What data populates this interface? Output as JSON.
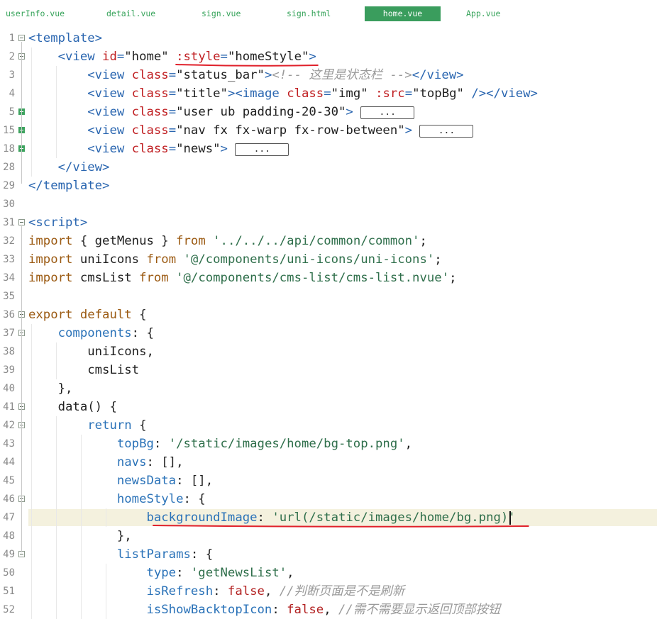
{
  "tabs": [
    {
      "label": "userInfo.vue",
      "active": false
    },
    {
      "label": "detail.vue",
      "active": false
    },
    {
      "label": "sign.vue",
      "active": false
    },
    {
      "label": "sign.html",
      "active": false
    },
    {
      "label": "home.vue",
      "active": true
    },
    {
      "label": "App.vue",
      "active": false
    }
  ],
  "colors": {
    "accent": "#3a9d5d",
    "current_line": "#f4f1de",
    "annotation_underline": "#e0202a"
  },
  "editor": {
    "current_line": "47",
    "lines": [
      {
        "num": "1",
        "fold": "collapse",
        "tokens": [
          {
            "t": "tag",
            "v": "<template>"
          }
        ]
      },
      {
        "num": "2",
        "fold": "collapse",
        "tokens": [
          {
            "t": "tag",
            "v": "    <view "
          },
          {
            "t": "attr",
            "v": "id"
          },
          {
            "t": "tag",
            "v": "="
          },
          {
            "t": "str",
            "v": "\"home\" "
          },
          {
            "t": "attr",
            "v": ":style"
          },
          {
            "t": "tag",
            "v": "="
          },
          {
            "t": "str",
            "v": "\"homeStyle\""
          },
          {
            "t": "tag",
            "v": ">"
          }
        ]
      },
      {
        "num": "3",
        "fold": "none",
        "tokens": [
          {
            "t": "tag",
            "v": "        <view "
          },
          {
            "t": "attr",
            "v": "class"
          },
          {
            "t": "tag",
            "v": "="
          },
          {
            "t": "str",
            "v": "\"status_bar\""
          },
          {
            "t": "tag",
            "v": ">"
          },
          {
            "t": "cmt",
            "v": "<!-- 这里是状态栏 -->"
          },
          {
            "t": "tag",
            "v": "</view>"
          }
        ]
      },
      {
        "num": "4",
        "fold": "none",
        "tokens": [
          {
            "t": "tag",
            "v": "        <view "
          },
          {
            "t": "attr",
            "v": "class"
          },
          {
            "t": "tag",
            "v": "="
          },
          {
            "t": "str",
            "v": "\"title\""
          },
          {
            "t": "tag",
            "v": "><image "
          },
          {
            "t": "attr",
            "v": "class"
          },
          {
            "t": "tag",
            "v": "="
          },
          {
            "t": "str",
            "v": "\"img\" "
          },
          {
            "t": "attr",
            "v": ":src"
          },
          {
            "t": "tag",
            "v": "="
          },
          {
            "t": "str",
            "v": "\"topBg\" "
          },
          {
            "t": "tag",
            "v": "/></view>"
          }
        ]
      },
      {
        "num": "5",
        "fold": "expand",
        "tokens": [
          {
            "t": "tag",
            "v": "        <view "
          },
          {
            "t": "attr",
            "v": "class"
          },
          {
            "t": "tag",
            "v": "="
          },
          {
            "t": "str",
            "v": "\"user ub padding-20-30\""
          },
          {
            "t": "tag",
            "v": "> "
          },
          {
            "t": "box",
            "v": "..."
          }
        ]
      },
      {
        "num": "15",
        "fold": "expand",
        "tokens": [
          {
            "t": "tag",
            "v": "        <view "
          },
          {
            "t": "attr",
            "v": "class"
          },
          {
            "t": "tag",
            "v": "="
          },
          {
            "t": "str",
            "v": "\"nav fx fx-warp fx-row-between\""
          },
          {
            "t": "tag",
            "v": "> "
          },
          {
            "t": "box",
            "v": "..."
          }
        ]
      },
      {
        "num": "18",
        "fold": "expand",
        "tokens": [
          {
            "t": "tag",
            "v": "        <view "
          },
          {
            "t": "attr",
            "v": "class"
          },
          {
            "t": "tag",
            "v": "="
          },
          {
            "t": "str",
            "v": "\"news\""
          },
          {
            "t": "tag",
            "v": "> "
          },
          {
            "t": "box",
            "v": "..."
          }
        ]
      },
      {
        "num": "28",
        "fold": "none",
        "tokens": [
          {
            "t": "tag",
            "v": "    </view>"
          }
        ]
      },
      {
        "num": "29",
        "fold": "none",
        "tokens": [
          {
            "t": "tag",
            "v": "</template>"
          }
        ]
      },
      {
        "num": "30",
        "fold": "none",
        "tokens": []
      },
      {
        "num": "31",
        "fold": "collapse",
        "tokens": [
          {
            "t": "tag",
            "v": "<script>"
          }
        ]
      },
      {
        "num": "32",
        "fold": "none",
        "tokens": [
          {
            "t": "kw",
            "v": "import "
          },
          {
            "t": "fn",
            "v": "{ getMenus } "
          },
          {
            "t": "kw",
            "v": "from "
          },
          {
            "t": "sstr",
            "v": "'../../../api/common/common'"
          },
          {
            "t": "op",
            "v": ";"
          }
        ]
      },
      {
        "num": "33",
        "fold": "none",
        "tokens": [
          {
            "t": "kw",
            "v": "import "
          },
          {
            "t": "fn",
            "v": "uniIcons "
          },
          {
            "t": "kw",
            "v": "from "
          },
          {
            "t": "sstr",
            "v": "'@/components/uni-icons/uni-icons'"
          },
          {
            "t": "op",
            "v": ";"
          }
        ]
      },
      {
        "num": "34",
        "fold": "none",
        "tokens": [
          {
            "t": "kw",
            "v": "import "
          },
          {
            "t": "fn",
            "v": "cmsList "
          },
          {
            "t": "kw",
            "v": "from "
          },
          {
            "t": "sstr",
            "v": "'@/components/cms-list/cms-list.nvue'"
          },
          {
            "t": "op",
            "v": ";"
          }
        ]
      },
      {
        "num": "35",
        "fold": "none",
        "tokens": []
      },
      {
        "num": "36",
        "fold": "collapse",
        "tokens": [
          {
            "t": "kw",
            "v": "export default "
          },
          {
            "t": "op",
            "v": "{"
          }
        ]
      },
      {
        "num": "37",
        "fold": "collapse",
        "tokens": [
          {
            "t": "prop",
            "v": "    components"
          },
          {
            "t": "op",
            "v": ": {"
          }
        ]
      },
      {
        "num": "38",
        "fold": "none",
        "tokens": [
          {
            "t": "fn",
            "v": "        uniIcons,"
          }
        ]
      },
      {
        "num": "39",
        "fold": "none",
        "tokens": [
          {
            "t": "fn",
            "v": "        cmsList"
          }
        ]
      },
      {
        "num": "40",
        "fold": "none",
        "tokens": [
          {
            "t": "op",
            "v": "    },"
          }
        ]
      },
      {
        "num": "41",
        "fold": "collapse",
        "tokens": [
          {
            "t": "fn",
            "v": "    data() {"
          }
        ]
      },
      {
        "num": "42",
        "fold": "collapse",
        "tokens": [
          {
            "t": "ctrl",
            "v": "        return "
          },
          {
            "t": "op",
            "v": "{"
          }
        ]
      },
      {
        "num": "43",
        "fold": "none",
        "tokens": [
          {
            "t": "prop",
            "v": "            topBg"
          },
          {
            "t": "op",
            "v": ": "
          },
          {
            "t": "sstr",
            "v": "'/static/images/home/bg-top.png'"
          },
          {
            "t": "op",
            "v": ","
          }
        ]
      },
      {
        "num": "44",
        "fold": "none",
        "tokens": [
          {
            "t": "prop",
            "v": "            navs"
          },
          {
            "t": "op",
            "v": ": [],"
          }
        ]
      },
      {
        "num": "45",
        "fold": "none",
        "tokens": [
          {
            "t": "prop",
            "v": "            newsData"
          },
          {
            "t": "op",
            "v": ": [],"
          }
        ]
      },
      {
        "num": "46",
        "fold": "collapse",
        "tokens": [
          {
            "t": "prop",
            "v": "            homeStyle"
          },
          {
            "t": "op",
            "v": ": {"
          }
        ]
      },
      {
        "num": "47",
        "fold": "none",
        "tokens": [
          {
            "t": "prop",
            "v": "                backgroundImage"
          },
          {
            "t": "op",
            "v": ": "
          },
          {
            "t": "sstr",
            "v": "'url(/static/images/home/bg.png)'"
          }
        ]
      },
      {
        "num": "48",
        "fold": "none",
        "tokens": [
          {
            "t": "op",
            "v": "            },"
          }
        ]
      },
      {
        "num": "49",
        "fold": "collapse",
        "tokens": [
          {
            "t": "prop",
            "v": "            listParams"
          },
          {
            "t": "op",
            "v": ": {"
          }
        ]
      },
      {
        "num": "50",
        "fold": "none",
        "tokens": [
          {
            "t": "prop",
            "v": "                type"
          },
          {
            "t": "op",
            "v": ": "
          },
          {
            "t": "sstr",
            "v": "'getNewsList'"
          },
          {
            "t": "op",
            "v": ","
          }
        ]
      },
      {
        "num": "51",
        "fold": "none",
        "tokens": [
          {
            "t": "prop",
            "v": "                isRefresh"
          },
          {
            "t": "op",
            "v": ": "
          },
          {
            "t": "bool",
            "v": "false"
          },
          {
            "t": "op",
            "v": ", "
          },
          {
            "t": "cmt",
            "v": "//判断页面是不是刷新"
          }
        ]
      },
      {
        "num": "52",
        "fold": "none",
        "tokens": [
          {
            "t": "prop",
            "v": "                isShowBacktopIcon"
          },
          {
            "t": "op",
            "v": ": "
          },
          {
            "t": "bool",
            "v": "false"
          },
          {
            "t": "op",
            "v": ", "
          },
          {
            "t": "cmt",
            "v": "//需不需要显示返回顶部按钮"
          }
        ]
      }
    ]
  }
}
